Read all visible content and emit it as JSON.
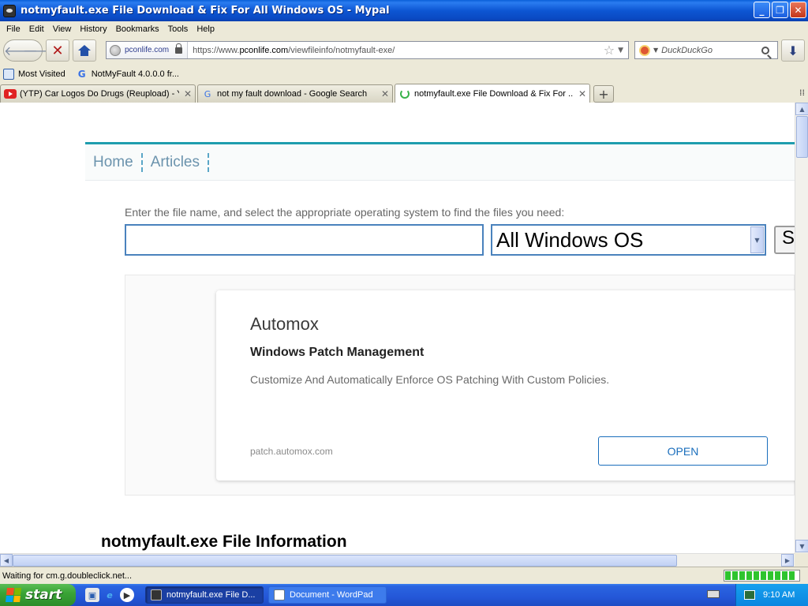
{
  "window": {
    "title": "notmyfault.exe File Download & Fix For All Windows OS - Mypal"
  },
  "menu": [
    "File",
    "Edit",
    "View",
    "History",
    "Bookmarks",
    "Tools",
    "Help"
  ],
  "toolbar": {
    "site_identity": "pconlife.com",
    "url_prefix": "https://www.",
    "url_domain": "pconlife.com",
    "url_path": "/viewfileinfo/notmyfault-exe/",
    "search_placeholder": "DuckDuckGo"
  },
  "bookmarks": [
    {
      "label": "Most Visited",
      "icon": "most-visited-icon"
    },
    {
      "label": "NotMyFault 4.0.0.0 fr...",
      "icon": "google-icon"
    }
  ],
  "tabs": [
    {
      "label": "(YTP) Car Logos Do Drugs (Reupload) - Y...",
      "icon": "youtube-icon"
    },
    {
      "label": "not my fault download - Google Search",
      "icon": "google-icon"
    },
    {
      "label": "notmyfault.exe File Download & Fix For ...",
      "icon": "loading-icon",
      "active": true
    }
  ],
  "page": {
    "nav": [
      "Home",
      "Articles"
    ],
    "search_label": "Enter the file name, and select the appropriate operating system to find the files you need:",
    "filename_value": "",
    "os_selected": "All Windows OS",
    "search_button": "S",
    "ad": {
      "title": "Automox",
      "subtitle": "Windows Patch Management",
      "description": "Customize And Automatically Enforce OS Patching With Custom Policies.",
      "url": "patch.automox.com",
      "button": "OPEN"
    },
    "heading": "notmyfault.exe File Information"
  },
  "status": {
    "text": "Waiting for cm.g.doubleclick.net..."
  },
  "taskbar": {
    "start": "start",
    "tasks": [
      {
        "label": "notmyfault.exe File D...",
        "active": true
      },
      {
        "label": "Document - WordPad",
        "active": false
      }
    ],
    "clock": "9:10 AM"
  },
  "colors": {
    "accent": "#1f9dae",
    "link": "#6b93ad",
    "ad_button": "#1a6ebc"
  }
}
